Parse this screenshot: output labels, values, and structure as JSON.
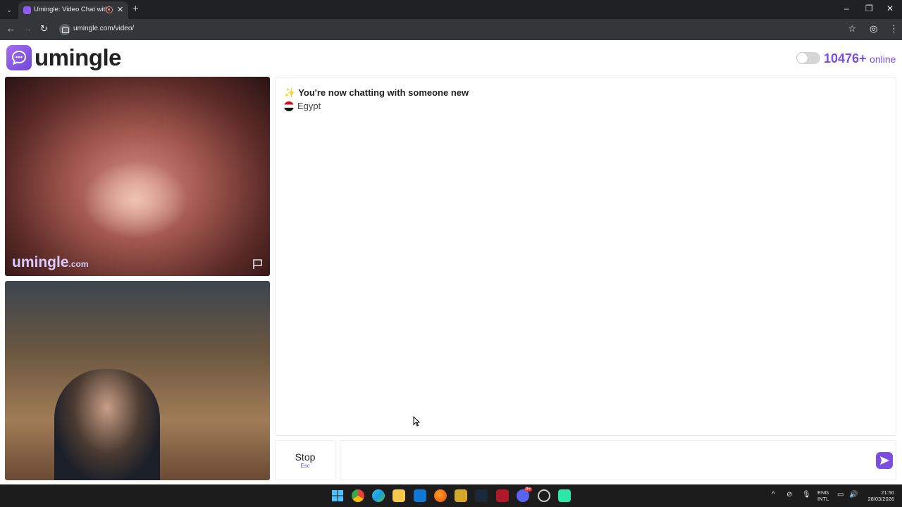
{
  "browser": {
    "tab_title": "Umingle: Video Chat with S",
    "url": "umingle.com/video/",
    "new_tab_symbol": "+",
    "close_symbol": "✕"
  },
  "header": {
    "logo_text": "umingle",
    "online_count": "10476+",
    "online_label": "online",
    "toggle_on": false,
    "accent_color": "#7a4fe0"
  },
  "video": {
    "watermark": "umingle",
    "watermark_domain": ".com"
  },
  "chat": {
    "system_message": "You're now chatting with someone new",
    "country": "Egypt",
    "flag_icon": "egypt-flag-icon"
  },
  "controls": {
    "stop_label": "Stop",
    "stop_hint": "Esc",
    "message_placeholder": ""
  },
  "taskbar": {
    "lang_line1": "ENG",
    "lang_line2": "INTL",
    "time": "21:50",
    "date": "28/03/2026",
    "discord_badge": "9+"
  }
}
